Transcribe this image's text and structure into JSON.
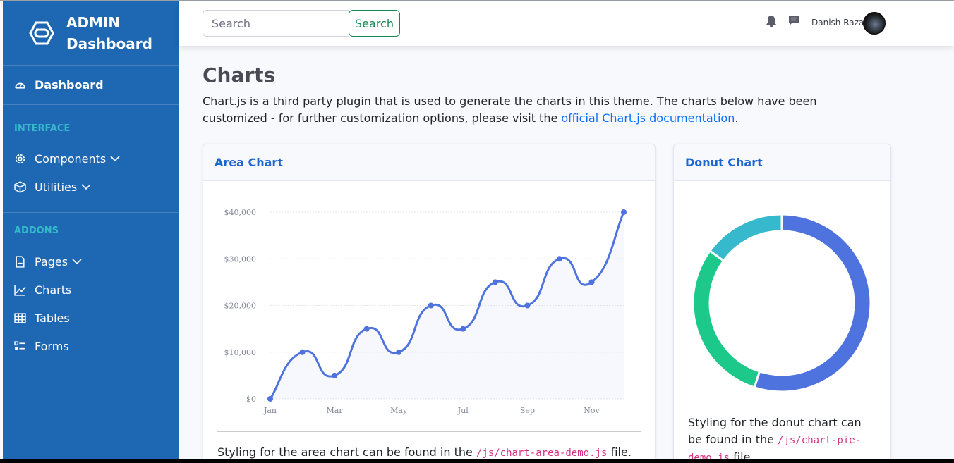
{
  "sidebar": {
    "brand_line1": "ADMIN",
    "brand_line2": "Dashboard",
    "dashboard_label": "Dashboard",
    "section_interface": "INTERFACE",
    "components_label": "Components",
    "utilities_label": "Utilities",
    "section_addons": "ADDONS",
    "pages_label": "Pages",
    "charts_label": "Charts",
    "tables_label": "Tables",
    "forms_label": "Forms"
  },
  "topbar": {
    "search_placeholder": "Search",
    "search_button": "Search",
    "user_name": "Danish Raza"
  },
  "main": {
    "title": "Charts",
    "intro_text": "Chart.js is a third party plugin that is used to generate the charts in this theme. The charts below have been customized - for further customization options, please visit the ",
    "intro_link": "official Chart.js documentation",
    "intro_end": ".",
    "area_card_title": "Area Chart",
    "area_foot_text": "Styling for the area chart can be found in the ",
    "area_foot_code": "/js/chart-area-demo.js",
    "area_foot_end": " file.",
    "donut_card_title": "Donut Chart",
    "donut_foot_text": "Styling for the donut chart can be found in the ",
    "donut_foot_code": "/js/chart-pie-demo.js",
    "donut_foot_end": " file."
  },
  "colors": {
    "sidebar_bg": "#1e67b3",
    "accent_cyan": "#36b9cc",
    "line_blue": "#4e73df",
    "donut_green": "#1cc88a"
  },
  "chart_data": [
    {
      "type": "area",
      "x": [
        "Jan",
        "Feb",
        "Mar",
        "Apr",
        "May",
        "Jun",
        "Jul",
        "Aug",
        "Sep",
        "Oct",
        "Nov",
        "Dec"
      ],
      "x_tick_labels": [
        "Jan",
        "Mar",
        "May",
        "Jul",
        "Sep",
        "Nov"
      ],
      "values": [
        0,
        10000,
        5000,
        15000,
        10000,
        20000,
        15000,
        25000,
        20000,
        30000,
        25000,
        40000
      ],
      "y_tick_labels": [
        "$0",
        "$10,000",
        "$20,000",
        "$30,000",
        "$40,000"
      ],
      "ylim": [
        0,
        40000
      ],
      "grid": true,
      "color": "#4e73df"
    },
    {
      "type": "pie",
      "donut": true,
      "values": [
        55,
        30,
        15
      ],
      "colors": [
        "#4e73df",
        "#1cc88a",
        "#36b9cc"
      ]
    }
  ]
}
